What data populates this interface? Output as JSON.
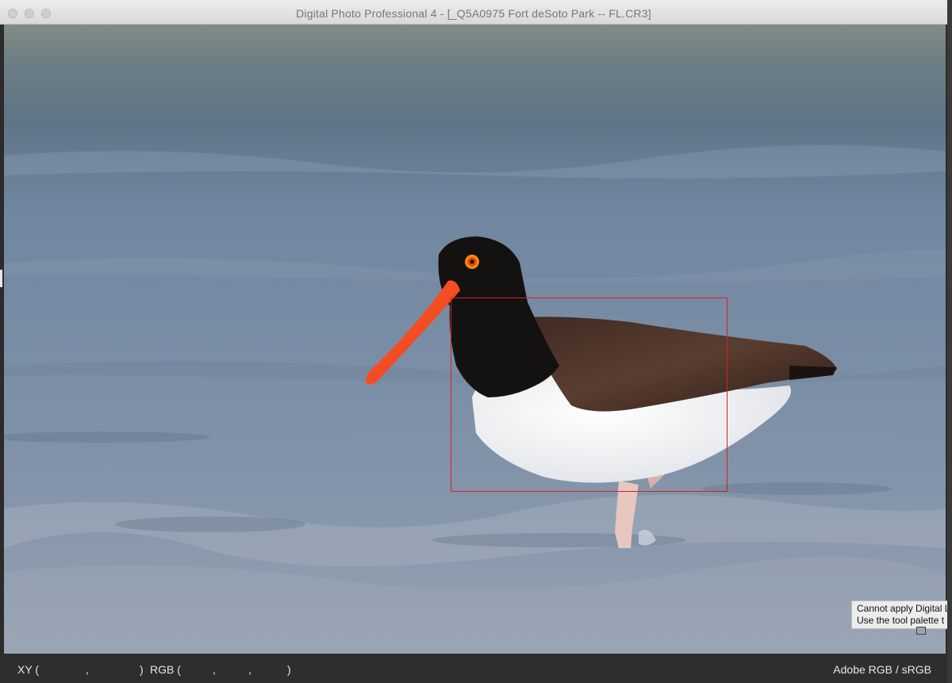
{
  "window": {
    "title": "Digital Photo Professional 4 - [_Q5A0975 Fort deSoto Park -- FL.CR3]"
  },
  "status_bar": {
    "xy_label": "XY (",
    "xy_sep": ",",
    "xy_close": ")",
    "rgb_label": "RGB (",
    "rgb_sep1": ",",
    "rgb_sep2": ",",
    "rgb_close": ")",
    "color_space": "Adobe RGB / sRGB"
  },
  "tooltip": {
    "line1": "Cannot apply Digital L",
    "line2": "Use the tool palette t"
  },
  "colors": {
    "focus_frame": "#d82020",
    "bill": "#e8401c",
    "eye_ring": "#f08a10"
  }
}
